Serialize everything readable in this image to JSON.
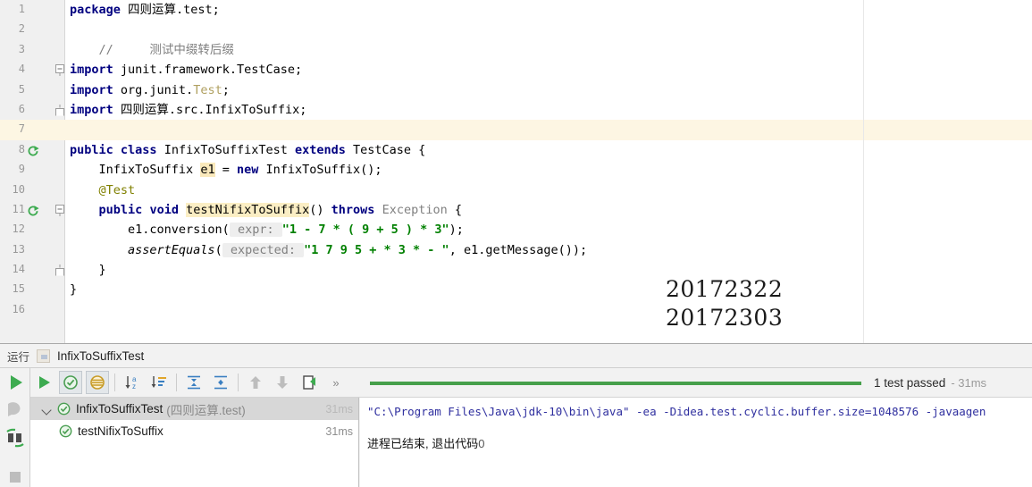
{
  "editor": {
    "margin_column_x": 966,
    "highlighted_line": 7,
    "lines": [
      {
        "n": "1",
        "marker": null,
        "fold": null,
        "text_html": "<span class=\"kw\">package</span> 四则运算.test;"
      },
      {
        "n": "2",
        "marker": null,
        "fold": null,
        "text_html": ""
      },
      {
        "n": "3",
        "marker": null,
        "fold": null,
        "text_html": "    <span class=\"cmt\">//     测试中缀转后缀</span>"
      },
      {
        "n": "4",
        "marker": null,
        "fold": "start",
        "text_html": "<span class=\"kw\">import</span> junit.framework.TestCase;"
      },
      {
        "n": "5",
        "marker": null,
        "fold": null,
        "text_html": "<span class=\"kw\">import</span> org.junit.<span class=\"grayid\">Test</span>;"
      },
      {
        "n": "6",
        "marker": null,
        "fold": "end",
        "text_html": "<span class=\"kw\">import</span> 四则运算.src.InfixToSuffix;"
      },
      {
        "n": "7",
        "marker": null,
        "fold": null,
        "text_html": ""
      },
      {
        "n": "8",
        "marker": "run",
        "fold": null,
        "text_html": "<span class=\"kw\">public</span> <span class=\"kw\">class</span> InfixToSuffixTest <span class=\"kw\">extends</span> TestCase {"
      },
      {
        "n": "9",
        "marker": null,
        "fold": null,
        "text_html": "    InfixToSuffix <span class=\"hl-ident\">e1</span> = <span class=\"kw\">new</span> InfixToSuffix();"
      },
      {
        "n": "10",
        "marker": null,
        "fold": null,
        "text_html": "    <span class=\"ann\">@Test</span>"
      },
      {
        "n": "11",
        "marker": "run",
        "fold": "start",
        "text_html": "    <span class=\"kw\">public</span> <span class=\"kw\">void</span> <span class=\"hl-ident2\">testNifixToSuffix</span>() <span class=\"kw\">throws</span> <span class=\"cmt\">Exception</span> {"
      },
      {
        "n": "12",
        "marker": null,
        "fold": null,
        "text_html": "        e1.conversion(<span class=\"param-hint\"> expr: </span><span class=\"str\">\"1 - 7 * ( 9 + 5 ) * 3\"</span>);"
      },
      {
        "n": "13",
        "marker": null,
        "fold": null,
        "text_html": "        <span class=\"ital\">assertEquals</span>(<span class=\"param-hint\"> expected: </span><span class=\"str\">\"1 7 9 5 + * 3 * - \"</span>, e1.getMessage());"
      },
      {
        "n": "14",
        "marker": null,
        "fold": "end",
        "text_html": "    }"
      },
      {
        "n": "15",
        "marker": null,
        "fold": null,
        "text_html": "}"
      },
      {
        "n": "16",
        "marker": null,
        "fold": null,
        "text_html": ""
      }
    ],
    "overlay_ids": [
      "20172322",
      "20172303"
    ]
  },
  "run_panel": {
    "tool_window_label": "运行",
    "configuration_name": "InfixToSuffixTest",
    "left_rail": [
      {
        "name": "rerun-icon",
        "title": "Rerun"
      },
      {
        "name": "toggle-auto-test-icon",
        "title": "Toggle auto-test"
      },
      {
        "name": "import-tests-icon",
        "title": "Import Tests"
      },
      {
        "name": "stop-icon",
        "title": "Stop"
      }
    ],
    "toolbar": [
      {
        "name": "rerun-tests-icon",
        "label": "Rerun tests",
        "state": "normal"
      },
      {
        "name": "show-passed-icon",
        "label": "Show passed",
        "state": "active"
      },
      {
        "name": "show-ignored-icon",
        "label": "Show ignored",
        "state": "active"
      },
      {
        "name": "sort-alphabetically-icon",
        "label": "Sort alphabetically",
        "state": "normal"
      },
      {
        "name": "sort-by-duration-icon",
        "label": "Sort by duration",
        "state": "normal"
      },
      {
        "name": "expand-all-icon",
        "label": "Expand all",
        "state": "normal"
      },
      {
        "name": "collapse-all-icon",
        "label": "Collapse all",
        "state": "normal"
      },
      {
        "name": "prev-failed-icon",
        "label": "Previous failed test",
        "state": "disabled"
      },
      {
        "name": "next-failed-icon",
        "label": "Next failed test",
        "state": "disabled"
      },
      {
        "name": "export-results-icon",
        "label": "Export test results",
        "state": "normal"
      },
      {
        "name": "more-options-icon",
        "label": "More",
        "state": "normal"
      }
    ],
    "progress": {
      "percent": 100,
      "status_text": "1 test passed",
      "status_time": "- 31ms",
      "bar_color": "#46a04b"
    },
    "tree": [
      {
        "name": "InfixToSuffixTest",
        "package": "(四则运算.test)",
        "time": "31ms",
        "status": "passed",
        "selected": true,
        "expanded": true,
        "level": 0
      },
      {
        "name": "testNifixToSuffix",
        "package": "",
        "time": "31ms",
        "status": "passed",
        "selected": false,
        "expanded": false,
        "level": 1
      }
    ],
    "console": {
      "command": "\"C:\\Program Files\\Java\\jdk-10\\bin\\java\" -ea -Didea.test.cyclic.buffer.size=1048576 -javaagen",
      "result_prefix": "进程已结束, 退出代码",
      "result_code": "0"
    }
  },
  "colors": {
    "accent_green": "#46a04b",
    "keyword_blue": "#000080",
    "string_green": "#008000",
    "comment_gray": "#808080",
    "highlight_yellow": "#fdf6e3",
    "selection_gray": "#d7d7d7"
  }
}
